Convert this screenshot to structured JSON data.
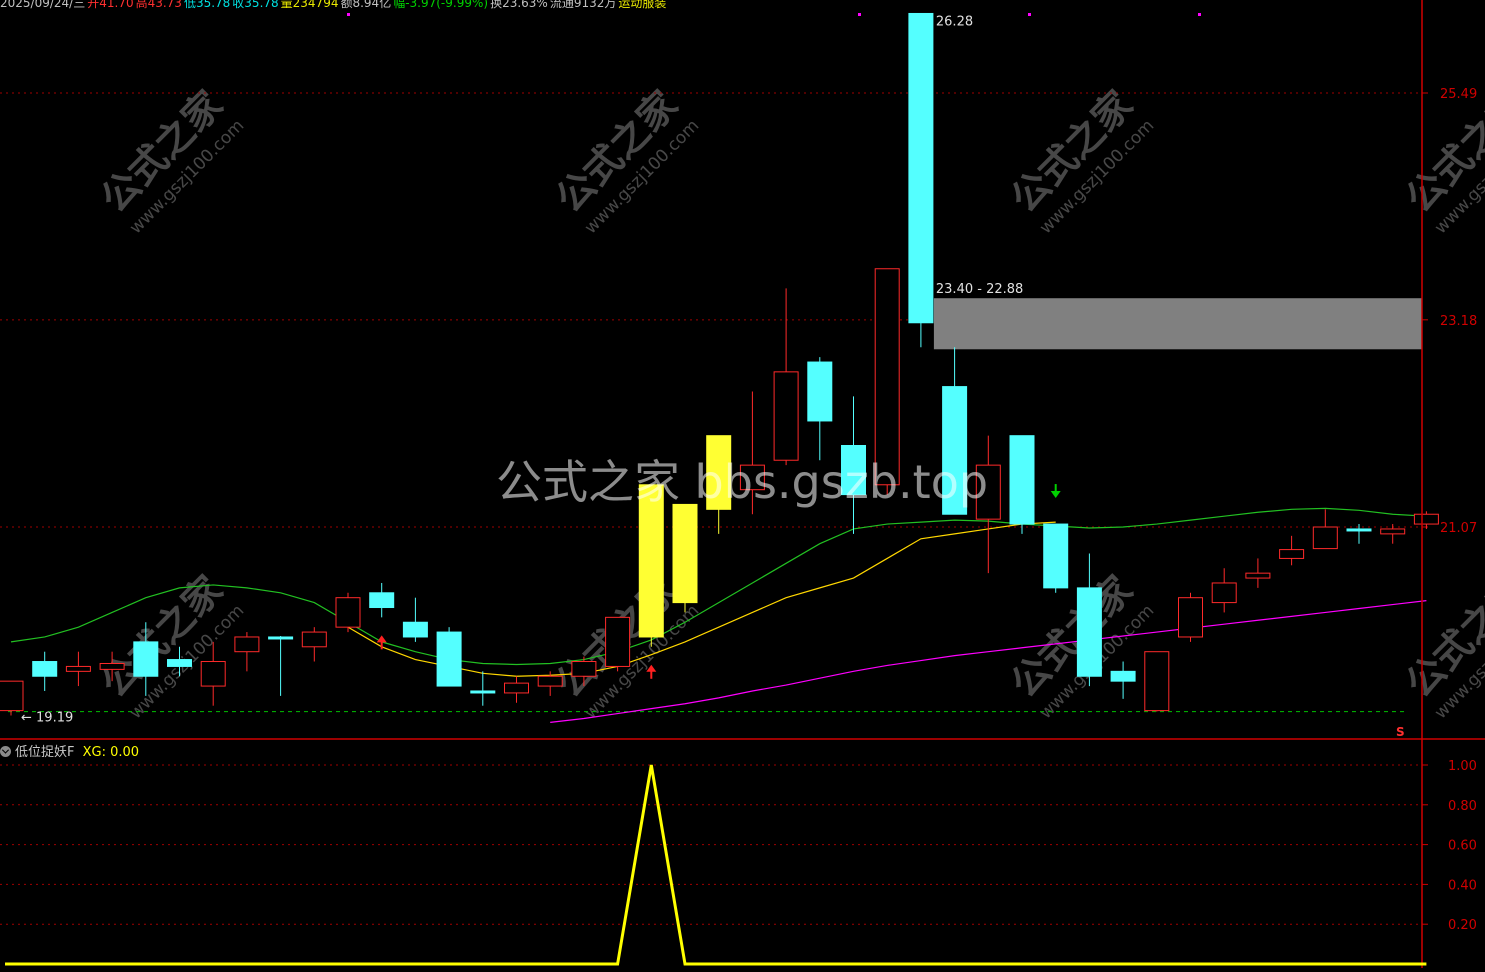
{
  "header": {
    "items": [
      {
        "text": "2025/09/24/三",
        "color": "#c0c0c0"
      },
      {
        "text": "开41.70",
        "color": "#ff3030"
      },
      {
        "text": "高43.73",
        "color": "#ff3030"
      },
      {
        "text": "低35.78",
        "color": "#00e0e0"
      },
      {
        "text": "收35.78",
        "color": "#00e0e0"
      },
      {
        "text": "量234794",
        "color": "#e8e800"
      },
      {
        "text": "额8.94亿",
        "color": "#c0c0c0"
      },
      {
        "text": "幅-3.97(-9.99%)",
        "color": "#00d000"
      },
      {
        "text": "换23.63%",
        "color": "#c0c0c0"
      },
      {
        "text": "流通9132万",
        "color": "#c0c0c0"
      },
      {
        "text": "运动服装",
        "color": "#e8e800"
      }
    ]
  },
  "indicator": {
    "name": "低位捉妖F",
    "label": "XG: 0.00"
  },
  "watermark": {
    "center_text": "公式之家 bbs.gszb.top",
    "tile_main": "公式之家",
    "tile_url": "www.gszj100.com"
  },
  "colors": {
    "up": "#ff2a2a",
    "down": "#54ffff",
    "highlight": "#ffff33",
    "ma_short": "#ffd700",
    "ma_mid": "#22c022",
    "ma_long": "#ff00ff",
    "xg": "#ffff00",
    "axis": "#d00000",
    "grid": "#a00000",
    "zone": "#808080"
  },
  "chart_data": [
    {
      "type": "candlestick",
      "price_axis_ticks": [
        "25.49",
        "23.18",
        "21.07"
      ],
      "high_label": "26.28",
      "low_label": "← 19.19",
      "zone_label": "23.40 - 22.88",
      "zone": [
        22.88,
        23.4
      ],
      "support_level": 19.19,
      "marker_s": "S",
      "candles": [
        {
          "o": 19.2,
          "h": 19.5,
          "l": 19.15,
          "c": 19.5,
          "d": "up"
        },
        {
          "o": 19.7,
          "h": 19.8,
          "l": 19.4,
          "c": 19.55,
          "d": "down"
        },
        {
          "o": 19.6,
          "h": 19.8,
          "l": 19.45,
          "c": 19.65,
          "d": "up"
        },
        {
          "o": 19.62,
          "h": 19.8,
          "l": 19.5,
          "c": 19.68,
          "d": "up"
        },
        {
          "o": 19.9,
          "h": 20.1,
          "l": 19.35,
          "c": 19.55,
          "d": "down",
          "s": "filled"
        },
        {
          "o": 19.72,
          "h": 19.85,
          "l": 19.55,
          "c": 19.65,
          "d": "down"
        },
        {
          "o": 19.45,
          "h": 19.9,
          "l": 19.25,
          "c": 19.7,
          "d": "up"
        },
        {
          "o": 19.8,
          "h": 20.0,
          "l": 19.6,
          "c": 19.95,
          "d": "up"
        },
        {
          "o": 19.95,
          "h": 19.96,
          "l": 19.35,
          "c": 19.95,
          "d": "down",
          "s": "doji"
        },
        {
          "o": 19.85,
          "h": 20.05,
          "l": 19.7,
          "c": 20.0,
          "d": "up"
        },
        {
          "o": 20.05,
          "h": 20.4,
          "l": 20.0,
          "c": 20.35,
          "d": "up"
        },
        {
          "o": 20.4,
          "h": 20.5,
          "l": 20.15,
          "c": 20.25,
          "d": "down"
        },
        {
          "o": 20.1,
          "h": 20.35,
          "l": 19.9,
          "c": 19.95,
          "d": "down"
        },
        {
          "o": 20.0,
          "h": 20.05,
          "l": 19.45,
          "c": 19.45,
          "d": "down"
        },
        {
          "o": 19.4,
          "h": 19.6,
          "l": 19.25,
          "c": 19.4,
          "d": "down",
          "s": "doji"
        },
        {
          "o": 19.38,
          "h": 19.55,
          "l": 19.28,
          "c": 19.48,
          "d": "up"
        },
        {
          "o": 19.45,
          "h": 19.6,
          "l": 19.35,
          "c": 19.55,
          "d": "up"
        },
        {
          "o": 19.55,
          "h": 19.75,
          "l": 19.45,
          "c": 19.7,
          "d": "up"
        },
        {
          "o": 19.65,
          "h": 20.15,
          "l": 19.6,
          "c": 20.15,
          "d": "up"
        },
        {
          "o": 19.95,
          "h": 21.5,
          "l": 19.85,
          "c": 21.5,
          "d": "up",
          "s": "yellow"
        },
        {
          "o": 20.3,
          "h": 21.3,
          "l": 20.2,
          "c": 21.3,
          "d": "up",
          "s": "yellow"
        },
        {
          "o": 21.25,
          "h": 22.0,
          "l": 21.0,
          "c": 22.0,
          "d": "up",
          "s": "yellow"
        },
        {
          "o": 21.45,
          "h": 22.45,
          "l": 21.2,
          "c": 21.7,
          "d": "up"
        },
        {
          "o": 21.75,
          "h": 23.5,
          "l": 21.7,
          "c": 22.65,
          "d": "up"
        },
        {
          "o": 22.75,
          "h": 22.8,
          "l": 21.75,
          "c": 22.15,
          "d": "down"
        },
        {
          "o": 21.9,
          "h": 22.4,
          "l": 21.0,
          "c": 21.4,
          "d": "down"
        },
        {
          "o": 21.5,
          "h": 23.7,
          "l": 21.4,
          "c": 23.7,
          "d": "up"
        },
        {
          "o": 26.3,
          "h": 26.3,
          "l": 22.9,
          "c": 23.15,
          "d": "down"
        },
        {
          "o": 22.5,
          "h": 22.9,
          "l": 21.2,
          "c": 21.2,
          "d": "down"
        },
        {
          "o": 21.15,
          "h": 22.0,
          "l": 20.6,
          "c": 21.7,
          "d": "up"
        },
        {
          "o": 22.0,
          "h": 22.0,
          "l": 21.0,
          "c": 21.1,
          "d": "down"
        },
        {
          "o": 21.1,
          "h": 21.1,
          "l": 20.4,
          "c": 20.45,
          "d": "down"
        },
        {
          "o": 20.45,
          "h": 20.8,
          "l": 19.45,
          "c": 19.55,
          "d": "down"
        },
        {
          "o": 19.6,
          "h": 19.7,
          "l": 19.32,
          "c": 19.5,
          "d": "down"
        },
        {
          "o": 19.2,
          "h": 19.8,
          "l": 19.19,
          "c": 19.8,
          "d": "up"
        },
        {
          "o": 19.95,
          "h": 20.4,
          "l": 19.9,
          "c": 20.35,
          "d": "up"
        },
        {
          "o": 20.3,
          "h": 20.65,
          "l": 20.2,
          "c": 20.5,
          "d": "up"
        },
        {
          "o": 20.55,
          "h": 20.75,
          "l": 20.45,
          "c": 20.6,
          "d": "up"
        },
        {
          "o": 20.75,
          "h": 20.98,
          "l": 20.68,
          "c": 20.84,
          "d": "up"
        },
        {
          "o": 20.85,
          "h": 21.25,
          "l": 20.85,
          "c": 21.07,
          "d": "up"
        },
        {
          "o": 21.05,
          "h": 21.1,
          "l": 20.9,
          "c": 21.05,
          "d": "down",
          "s": "doji"
        },
        {
          "o": 21.0,
          "h": 21.1,
          "l": 20.9,
          "c": 21.05,
          "d": "up"
        },
        {
          "o": 21.1,
          "h": 21.23,
          "l": 21.05,
          "c": 21.2,
          "d": "up"
        }
      ],
      "ma_short": [
        null,
        null,
        null,
        null,
        null,
        null,
        null,
        null,
        null,
        null,
        20.05,
        19.85,
        19.72,
        19.65,
        19.58,
        19.55,
        19.56,
        19.58,
        19.65,
        19.77,
        19.9,
        20.05,
        20.2,
        20.35,
        20.45,
        20.55,
        20.75,
        20.95,
        21.0,
        21.05,
        21.1,
        21.12
      ],
      "ma_mid": [
        19.9,
        19.95,
        20.05,
        20.2,
        20.35,
        20.45,
        20.48,
        20.45,
        20.4,
        20.3,
        20.1,
        19.9,
        19.8,
        19.72,
        19.68,
        19.67,
        19.68,
        19.72,
        19.8,
        19.92,
        20.1,
        20.3,
        20.5,
        20.7,
        20.9,
        21.05,
        21.1,
        21.12,
        21.14,
        21.13,
        21.1,
        21.08,
        21.06,
        21.07,
        21.1,
        21.14,
        21.18,
        21.22,
        21.25,
        21.26,
        21.24,
        21.2,
        21.18
      ],
      "ma_long": [
        null,
        null,
        null,
        null,
        null,
        null,
        null,
        null,
        null,
        null,
        null,
        null,
        null,
        null,
        null,
        null,
        19.08,
        19.12,
        19.17,
        19.22,
        19.27,
        19.33,
        19.4,
        19.46,
        19.53,
        19.6,
        19.66,
        19.71,
        19.76,
        19.8,
        19.84,
        19.88,
        19.92,
        19.96,
        20.0,
        20.04,
        20.08,
        20.12,
        20.16,
        20.2,
        20.24,
        20.28,
        20.32
      ],
      "signals": [
        {
          "i": 11,
          "type": "up-arrow"
        },
        {
          "i": 19,
          "type": "up-arrow"
        },
        {
          "i": 31,
          "type": "down-arrow"
        }
      ]
    },
    {
      "type": "line",
      "series": [
        {
          "name": "XG",
          "values": [
            0,
            0,
            0,
            0,
            0,
            0,
            0,
            0,
            0,
            0,
            0,
            0,
            0,
            0,
            0,
            0,
            0,
            0,
            0,
            1,
            0,
            0,
            0,
            0,
            0,
            0,
            0,
            0,
            0,
            0,
            0,
            0,
            0,
            0,
            0,
            0,
            0,
            0,
            0,
            0,
            0,
            0,
            0
          ]
        }
      ],
      "ylim": [
        0,
        1
      ],
      "y_ticks": [
        "1.00",
        "0.80",
        "0.60",
        "0.40",
        "0.20"
      ]
    }
  ]
}
